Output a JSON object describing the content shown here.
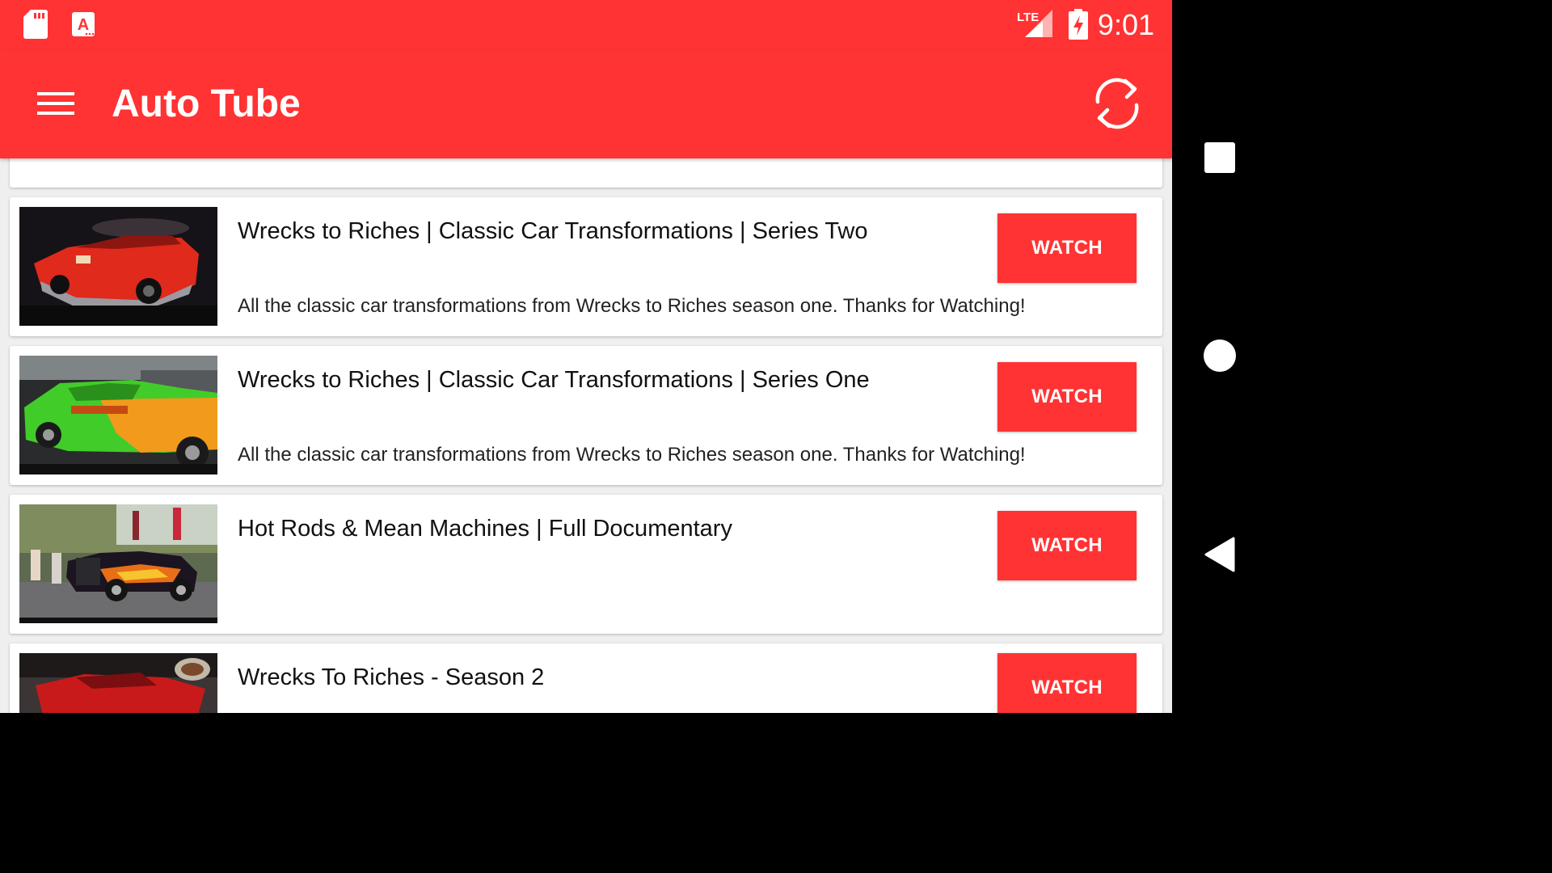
{
  "status_bar": {
    "time": "9:01",
    "lte_label": "LTE",
    "a_icon_letter": "A",
    "icons": [
      "sd-card-icon",
      "a-notification-icon",
      "lte-signal-icon",
      "battery-charging-icon"
    ]
  },
  "app_bar": {
    "title": "Auto Tube",
    "menu_icon": "hamburger-menu-icon",
    "refresh_icon": "refresh-icon"
  },
  "videos": [
    {
      "title": "Wrecks to Riches | Classic Car Transformations | Series Two",
      "description": "All the classic car transformations from Wrecks to Riches season one. Thanks for Watching!",
      "button": "WATCH"
    },
    {
      "title": "Wrecks to Riches | Classic Car Transformations | Series One",
      "description": "All the classic car transformations from Wrecks to Riches season one. Thanks for Watching!",
      "button": "WATCH"
    },
    {
      "title": "Hot Rods & Mean Machines | Full Documentary",
      "description": "",
      "button": "WATCH"
    },
    {
      "title": "Wrecks To Riches - Season 2",
      "description": "",
      "button": "WATCH"
    }
  ],
  "nav_bar": {
    "icons": [
      "recents-icon",
      "home-icon",
      "back-icon"
    ]
  },
  "colors": {
    "primary": "#ff3333",
    "background": "#efefef",
    "card": "#ffffff",
    "nav_bar": "#000000"
  }
}
